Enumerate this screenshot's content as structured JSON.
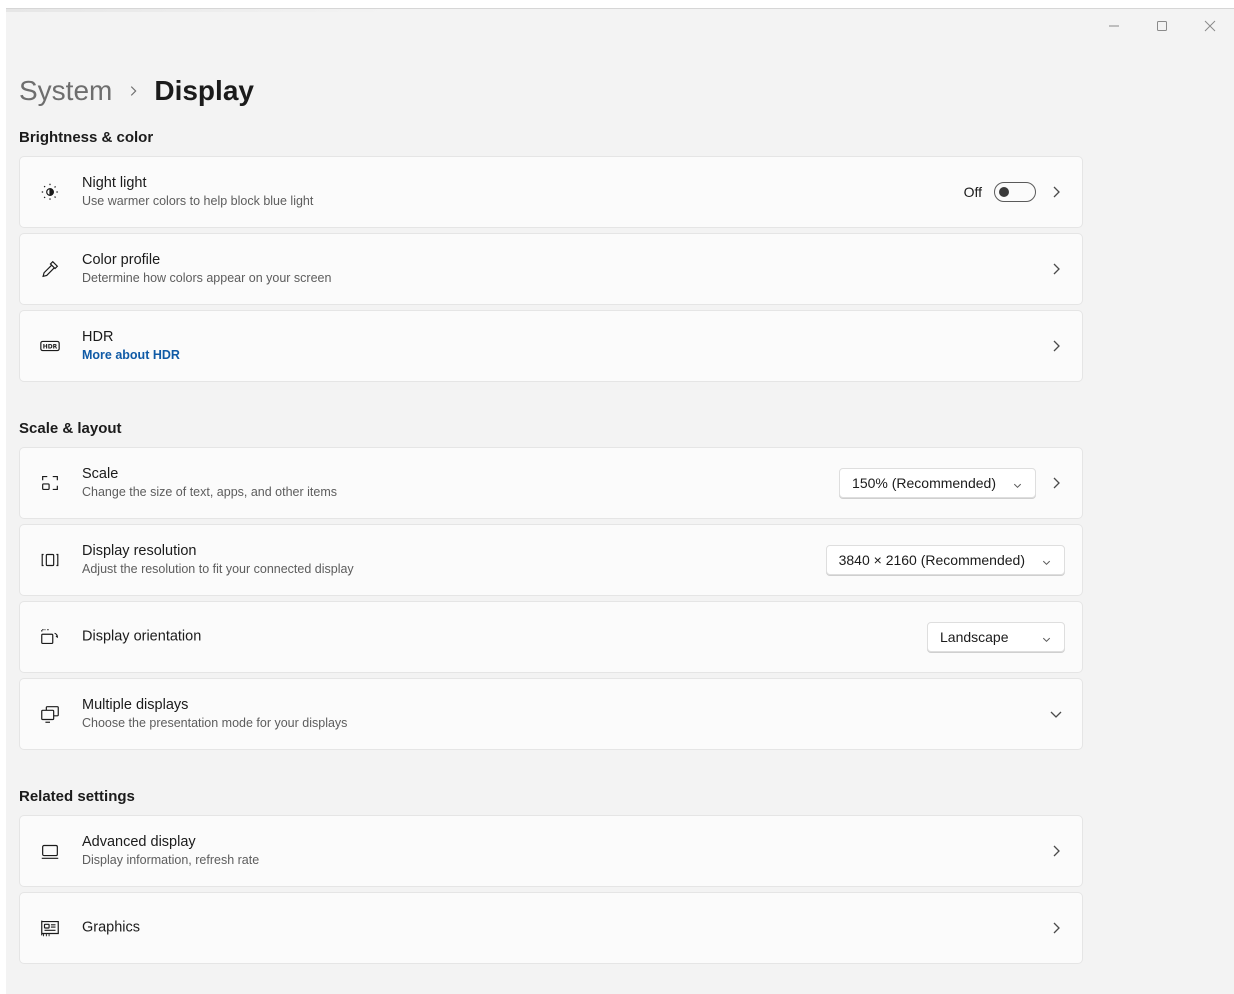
{
  "breadcrumb": {
    "parent": "System",
    "current": "Display"
  },
  "sections": {
    "brightness": "Brightness & color",
    "scale": "Scale & layout",
    "related": "Related settings"
  },
  "night_light": {
    "title": "Night light",
    "desc": "Use warmer colors to help block blue light",
    "state_label": "Off",
    "enabled": false,
    "icon": "night-light-icon"
  },
  "color_profile": {
    "title": "Color profile",
    "desc": "Determine how colors appear on your screen",
    "icon": "color-picker-icon"
  },
  "hdr": {
    "title": "HDR",
    "link": "More about HDR",
    "icon": "hdr-icon"
  },
  "scale": {
    "title": "Scale",
    "desc": "Change the size of text, apps, and other items",
    "value": "150% (Recommended)",
    "icon": "scale-icon"
  },
  "resolution": {
    "title": "Display resolution",
    "desc": "Adjust the resolution to fit your connected display",
    "value": "3840 × 2160 (Recommended)",
    "icon": "resolution-icon"
  },
  "orientation": {
    "title": "Display orientation",
    "value": "Landscape",
    "icon": "orientation-icon"
  },
  "multiple": {
    "title": "Multiple displays",
    "desc": "Choose the presentation mode for your displays",
    "icon": "multiple-displays-icon"
  },
  "advanced": {
    "title": "Advanced display",
    "desc": "Display information, refresh rate",
    "icon": "monitor-icon"
  },
  "graphics": {
    "title": "Graphics",
    "icon": "graphics-icon"
  },
  "colors": {
    "link": "#0f5aa6",
    "background": "#f3f3f3",
    "card": "#fbfbfb"
  }
}
